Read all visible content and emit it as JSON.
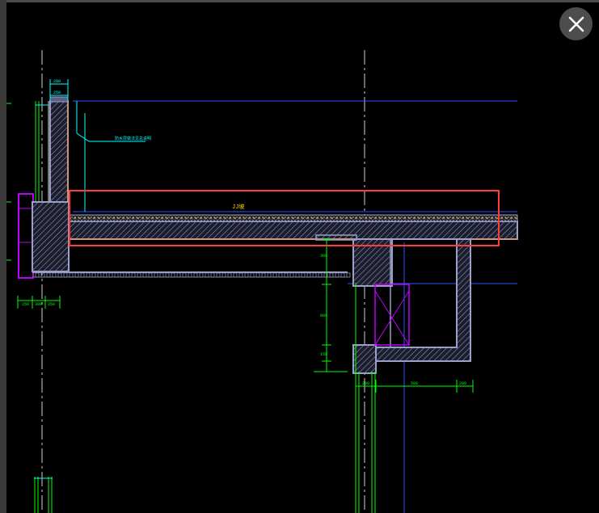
{
  "viewer": {
    "close_label": "Close",
    "close_icon": "close-icon"
  },
  "drawing": {
    "highlight_color": "#ff3b3b",
    "slab_label": "JJ坡",
    "note_label": "防水层做法见总说明",
    "top_dim_a": "200",
    "top_dim_b": "250",
    "left_dims": [
      "250",
      "300",
      "250"
    ],
    "bottom_dims": [
      "200",
      "500",
      "200"
    ],
    "vertical_dims": [
      "300",
      "600",
      "150"
    ],
    "colors": {
      "concrete": "#9aa0c8",
      "cyan": "#00ffff",
      "green": "#00ff00",
      "blue": "#2a56ff",
      "magenta": "#c000ff",
      "orange": "#ff8c2a",
      "yellow": "#ffd400",
      "white": "#e8e8e8"
    }
  }
}
